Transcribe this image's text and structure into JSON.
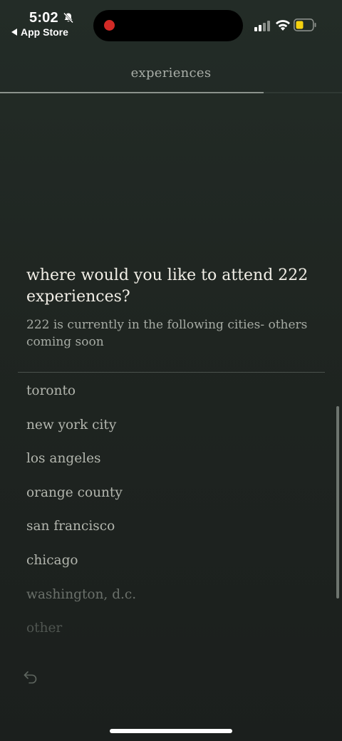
{
  "status": {
    "time": "5:02",
    "back_label": "App Store",
    "icons": [
      "bell-slash-icon",
      "recording-dot",
      "signal-icon",
      "wifi-icon",
      "battery-icon"
    ]
  },
  "header": {
    "title": "experiences",
    "progress": 0.77
  },
  "question": {
    "title": "where would you like to attend 222 experiences?",
    "subtitle": "222 is currently in the following cities- others coming soon"
  },
  "cities": [
    {
      "label": "toronto"
    },
    {
      "label": "new york city"
    },
    {
      "label": "los angeles"
    },
    {
      "label": "orange county"
    },
    {
      "label": "san francisco"
    },
    {
      "label": "chicago"
    },
    {
      "label": "washington, d.c."
    },
    {
      "label": "other"
    }
  ],
  "colors": {
    "background": "#1f2521",
    "text_primary": "#f2efe7",
    "text_secondary": "#a6aba4",
    "recording": "#d22a26",
    "battery_fill": "#f5d20f"
  },
  "footer": {
    "undo_icon": "undo-icon"
  }
}
